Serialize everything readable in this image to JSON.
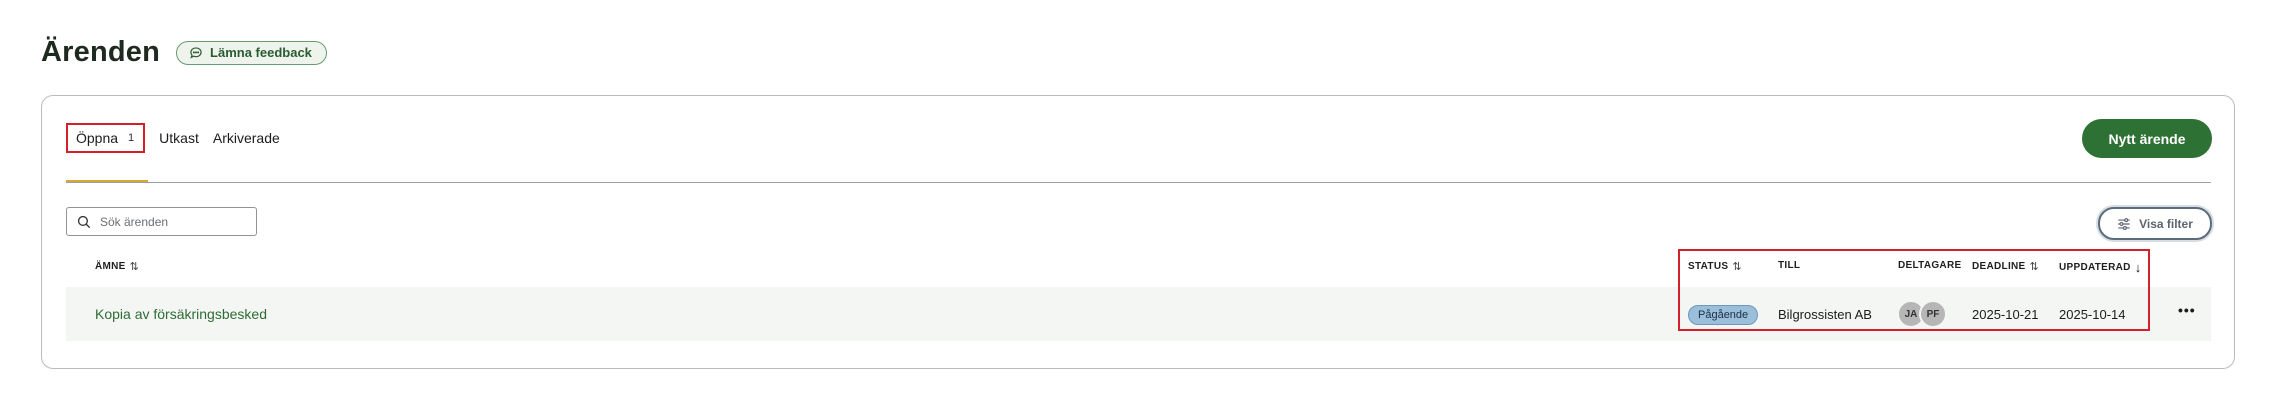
{
  "page": {
    "title": "Ärenden",
    "feedback_label": "Lämna feedback"
  },
  "tabs": [
    {
      "label": "Öppna",
      "count": "1",
      "active": true
    },
    {
      "label": "Utkast"
    },
    {
      "label": "Arkiverade"
    }
  ],
  "toolbar": {
    "new_label": "Nytt ärende",
    "search_placeholder": "Sök ärenden",
    "filter_label": "Visa filter"
  },
  "table": {
    "columns": {
      "subject": "ÄMNE",
      "status": "STATUS",
      "to": "TILL",
      "participants": "DELTAGARE",
      "deadline": "DEADLINE",
      "updated": "UPPDATERAD"
    },
    "rows": [
      {
        "subject": "Kopia av försäkringsbesked",
        "status": "Pågående",
        "to": "Bilgrossisten AB",
        "participants": [
          "JA",
          "PF"
        ],
        "deadline": "2025-10-21",
        "updated": "2025-10-14"
      }
    ]
  },
  "colors": {
    "primary": "#2e7134",
    "tab_underline": "#d9a833",
    "highlight": "#d3202b",
    "status_badge": "#9bbfdb"
  }
}
